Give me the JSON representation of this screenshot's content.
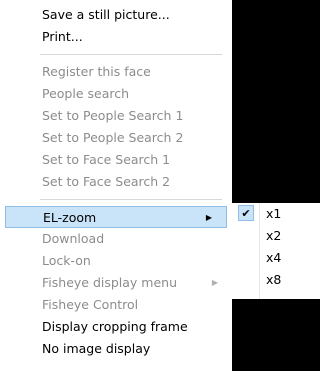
{
  "context_menu": {
    "items": [
      {
        "label": "Save a still picture...",
        "state": "enabled"
      },
      {
        "label": "Print...",
        "state": "enabled"
      },
      {
        "label": "Register this face",
        "state": "disabled"
      },
      {
        "label": "People search",
        "state": "disabled"
      },
      {
        "label": "Set to People Search 1",
        "state": "disabled"
      },
      {
        "label": "Set to People Search 2",
        "state": "disabled"
      },
      {
        "label": "Set to Face Search 1",
        "state": "disabled"
      },
      {
        "label": "Set to Face Search 2",
        "state": "disabled"
      },
      {
        "label": "EL-zoom",
        "state": "highlighted",
        "has_submenu": true
      },
      {
        "label": "Download",
        "state": "disabled"
      },
      {
        "label": "Lock-on",
        "state": "disabled"
      },
      {
        "label": "Fisheye display menu",
        "state": "disabled",
        "has_submenu": true
      },
      {
        "label": "Fisheye Control",
        "state": "disabled"
      },
      {
        "label": "Display cropping frame",
        "state": "enabled"
      },
      {
        "label": "No image display",
        "state": "enabled"
      }
    ],
    "submenu_arrow_glyph": "▶"
  },
  "zoom_submenu": {
    "items": [
      {
        "label": "x1",
        "checked": true
      },
      {
        "label": "x2",
        "checked": false
      },
      {
        "label": "x4",
        "checked": false
      },
      {
        "label": "x8",
        "checked": false
      }
    ],
    "check_glyph": "✔"
  },
  "colors": {
    "highlight_bg": "#c9e3f9",
    "highlight_border": "#8fbde6",
    "disabled_text": "#8c8c8c",
    "background": "#000000"
  }
}
